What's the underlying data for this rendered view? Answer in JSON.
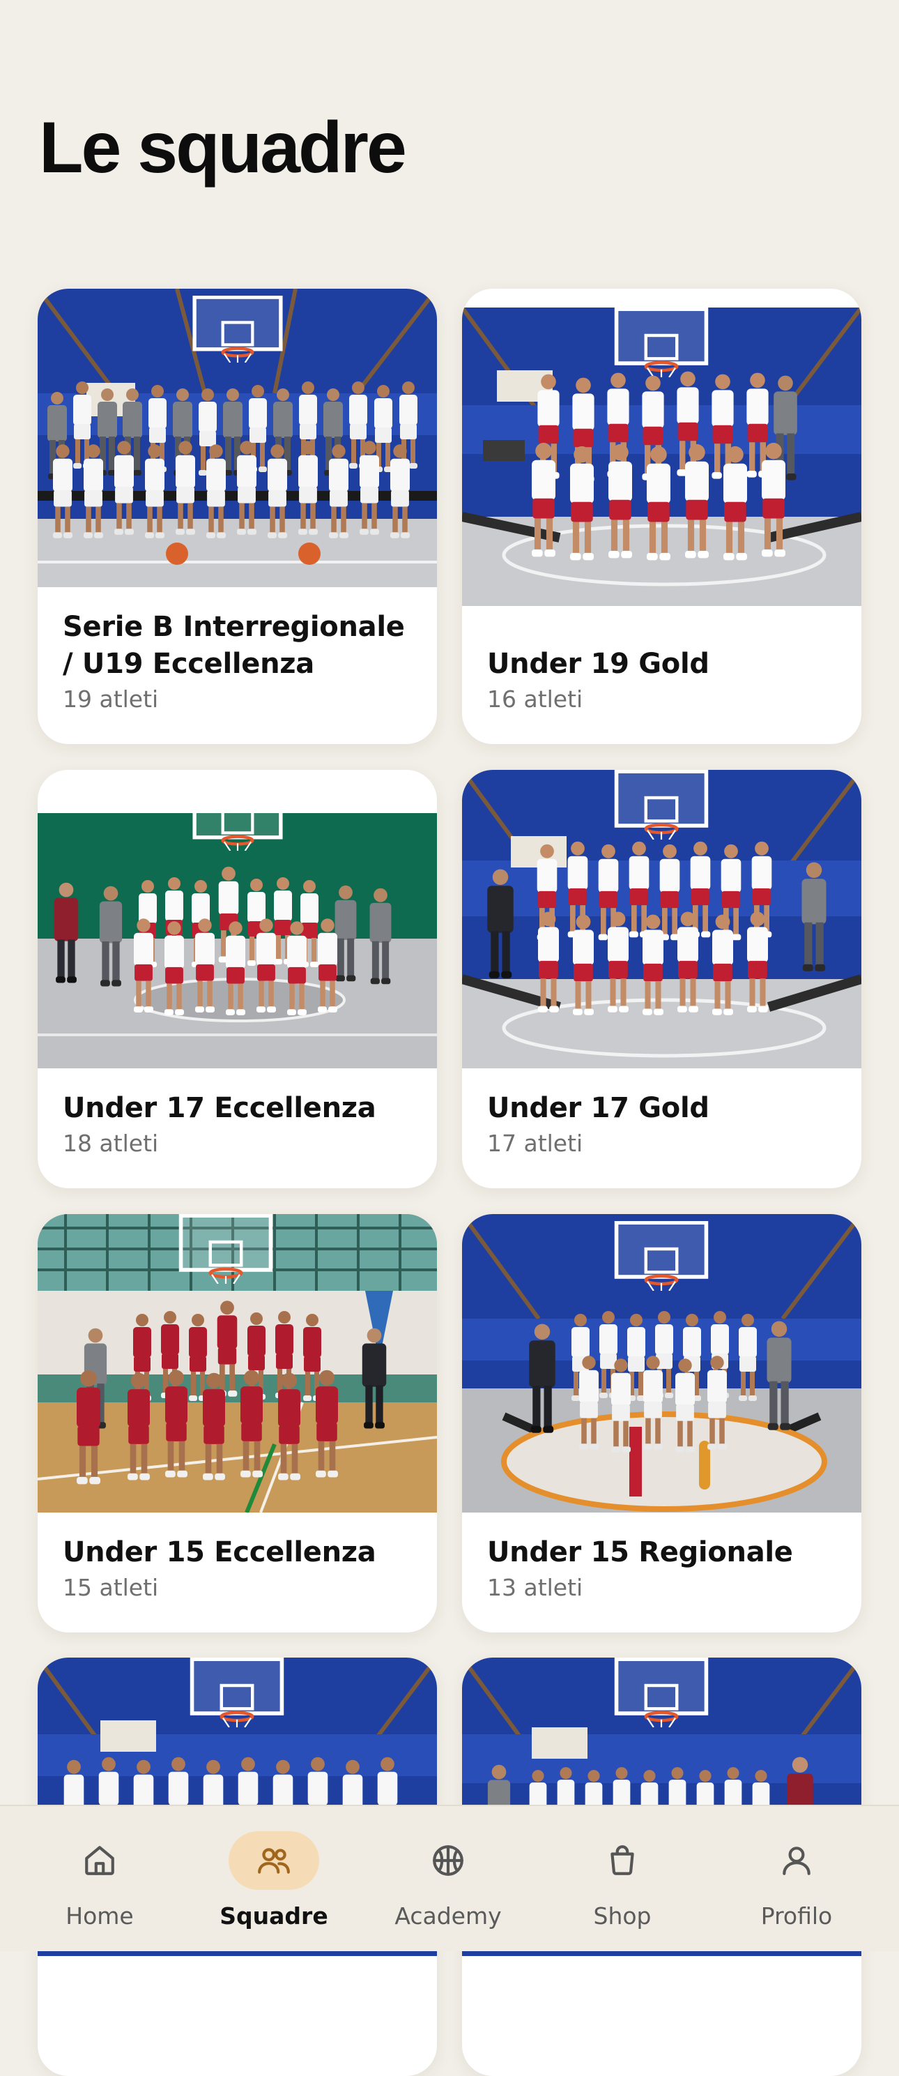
{
  "page": {
    "title": "Le squadre"
  },
  "teams": [
    {
      "name": "Serie B Interregionale / U19 Eccellenza",
      "athletes": "19 atleti",
      "photo": "photo-senior-team"
    },
    {
      "name": "Under 19 Gold",
      "athletes": "16 atleti",
      "photo": "photo-u19-gold"
    },
    {
      "name": "Under 17 Eccellenza",
      "athletes": "18 atleti",
      "photo": "photo-u17-eccellenza"
    },
    {
      "name": "Under 17 Gold",
      "athletes": "17 atleti",
      "photo": "photo-u17-gold"
    },
    {
      "name": "Under 15 Eccellenza",
      "athletes": "15 atleti",
      "photo": "photo-u15-eccellenza"
    },
    {
      "name": "Under 15 Regionale",
      "athletes": "13 atleti",
      "photo": "photo-u15-regionale"
    },
    {
      "photo": "photo-team-7"
    },
    {
      "photo": "photo-team-8"
    }
  ],
  "tabbar": {
    "active": "Squadre",
    "items": [
      {
        "label": "Home",
        "icon": "home-icon"
      },
      {
        "label": "Squadre",
        "icon": "people-icon"
      },
      {
        "label": "Academy",
        "icon": "basketball-icon"
      },
      {
        "label": "Shop",
        "icon": "shopping-bag-icon"
      },
      {
        "label": "Profilo",
        "icon": "user-icon"
      }
    ]
  },
  "colors": {
    "background": "#f2efe8",
    "card": "#ffffff",
    "active_tab_pill": "#f6dcb6",
    "text_primary": "#111111",
    "text_secondary": "#6f6f6f",
    "gym_wall": "#1e3fa0",
    "court_floor": "#c9cbcf",
    "jersey_red": "#b01c2e"
  }
}
